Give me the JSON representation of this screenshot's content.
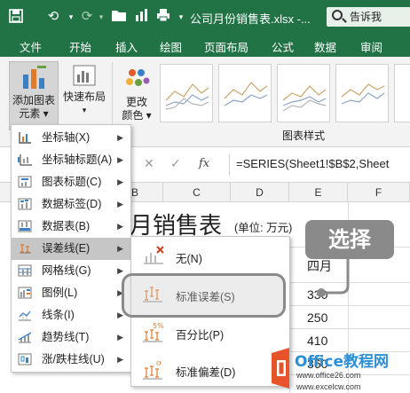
{
  "titlebar": {
    "doc_title": "公司月份销售表.xlsx  -...",
    "tell_me": "告诉我",
    "accent": "#217346"
  },
  "tabs": [
    "文件",
    "开始",
    "插入",
    "绘图",
    "页面布局",
    "公式",
    "数据",
    "审阅"
  ],
  "ribbon": {
    "add_chart_element": [
      "添加图表",
      "元素 ▾"
    ],
    "quick_layout": [
      "快速布局",
      "▾"
    ],
    "change_colors": [
      "更改",
      "颜色 ▾"
    ],
    "chart_styles_group": "图表样式"
  },
  "formula_bar": {
    "fx": "fx",
    "formula": "=SERIES(Sheet1!$B$2,Sheet"
  },
  "grid": {
    "columns": [
      "B",
      "C",
      "D",
      "E",
      "F"
    ],
    "title_fragment": "月销售表",
    "unit": "(单位: 万元)",
    "header_e": "四月",
    "values_e": [
      "330",
      "250",
      "410",
      "360"
    ]
  },
  "menu": {
    "items": [
      {
        "label": "坐标轴(X)",
        "icon": "axes-icon"
      },
      {
        "label": "坐标轴标题(A)",
        "icon": "axis-title-icon"
      },
      {
        "label": "图表标题(C)",
        "icon": "chart-title-icon"
      },
      {
        "label": "数据标签(D)",
        "icon": "data-labels-icon"
      },
      {
        "label": "数据表(B)",
        "icon": "data-table-icon"
      },
      {
        "label": "误差线(E)",
        "icon": "error-bars-icon"
      },
      {
        "label": "网格线(G)",
        "icon": "gridlines-icon"
      },
      {
        "label": "图例(L)",
        "icon": "legend-icon"
      },
      {
        "label": "线条(I)",
        "icon": "lines-icon"
      },
      {
        "label": "趋势线(T)",
        "icon": "trendline-icon"
      },
      {
        "label": "涨/跌柱线(U)",
        "icon": "up-down-bars-icon"
      }
    ]
  },
  "submenu": {
    "items": [
      {
        "label": "无(N)",
        "icon": "no-error-bars-icon"
      },
      {
        "label": "标准误差(S)",
        "icon": "standard-error-icon"
      },
      {
        "label": "百分比(P)",
        "icon": "percentage-icon"
      },
      {
        "label": "标准偏差(D)",
        "icon": "standard-deviation-icon"
      }
    ]
  },
  "callout": {
    "text": "选择",
    "color": "#8a8a8a"
  },
  "watermark": {
    "line1": "Office教程网",
    "line2": "www.office26.com",
    "line3": "www.excelcw.com"
  }
}
